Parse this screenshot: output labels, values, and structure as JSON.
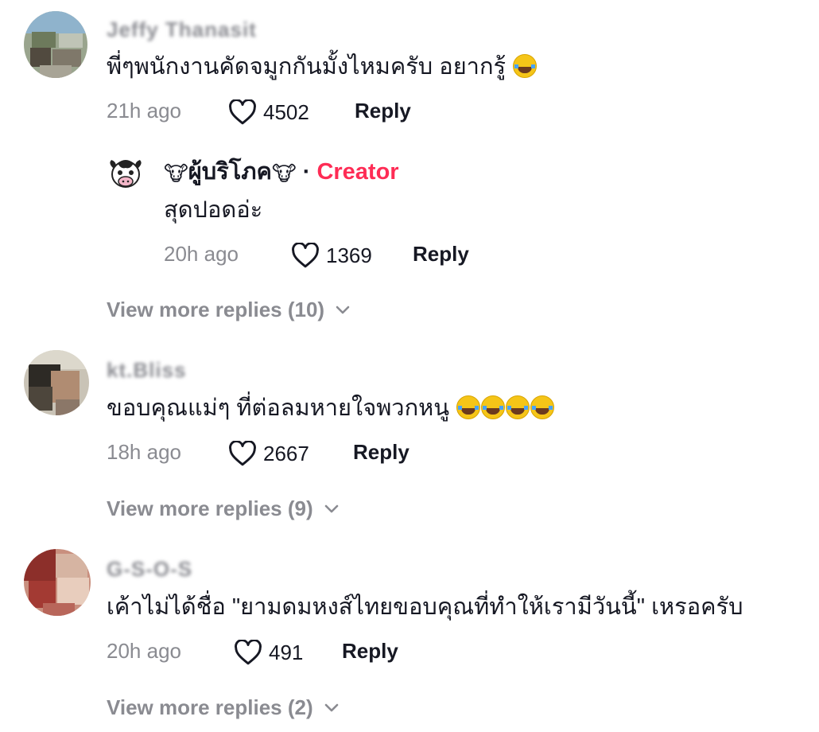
{
  "comments": [
    {
      "username": "Jeffy Thanasit",
      "text": "พี่ๆพนักงานคัดจมูกกันมั้งไหมครับ อยากรู้",
      "emoji_count": 1,
      "time": "21h ago",
      "likes": "4502",
      "reply_label": "Reply",
      "reply": {
        "username": "ผู้บริโภค",
        "badge": "Creator",
        "separator": "·",
        "cow_emoji": "🐮",
        "text": "สุดปอดอ่ะ",
        "time": "20h ago",
        "likes": "1369",
        "reply_label": "Reply"
      },
      "more_replies": "View more replies (10)"
    },
    {
      "username": "kt.Bliss",
      "text": "ขอบคุณแม่ๆ ที่ต่อลมหายใจพวกหนู",
      "emoji_count": 4,
      "time": "18h ago",
      "likes": "2667",
      "reply_label": "Reply",
      "more_replies": "View more replies (9)"
    },
    {
      "username": "G-S-O-S",
      "text": "เค้าไม่ได้ชื่อ \"ยามดมหงส์ไทยขอบคุณที่ทำให้เรามีวันนี้\" เหรอครับ",
      "emoji_count": 0,
      "time": "20h ago",
      "likes": "491",
      "reply_label": "Reply",
      "more_replies": "View more replies (2)"
    }
  ],
  "colors": {
    "secondary_text": "#8a8b91",
    "primary_text": "#161823",
    "creator_accent": "#fe2c55"
  },
  "icons": {
    "like": "heart-outline-icon",
    "expand": "chevron-down-icon",
    "laugh": "face-with-tears-of-joy-emoji"
  }
}
